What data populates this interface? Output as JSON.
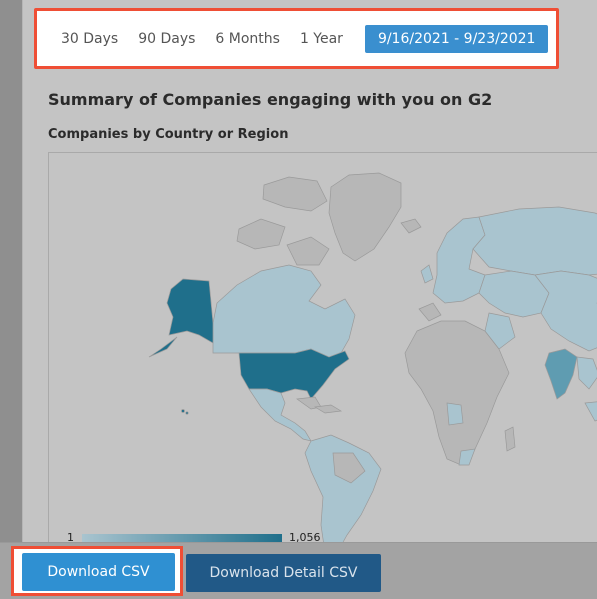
{
  "date_range": {
    "options": [
      "30 Days",
      "90 Days",
      "6 Months",
      "1 Year"
    ],
    "selected": "9/16/2021 - 9/23/2021"
  },
  "summary": {
    "title": "Summary of Companies engaging with you on G2"
  },
  "map": {
    "title": "Companies by Country or Region",
    "legend_min": "1",
    "legend_max": "1,056",
    "colors": {
      "low": "#a9c4cf",
      "high": "#1f6f8b",
      "no_data": "#b7b7b7",
      "border": "#9a9a9a"
    }
  },
  "actions": {
    "download_csv": "Download CSV",
    "download_detail_csv": "Download Detail CSV"
  }
}
